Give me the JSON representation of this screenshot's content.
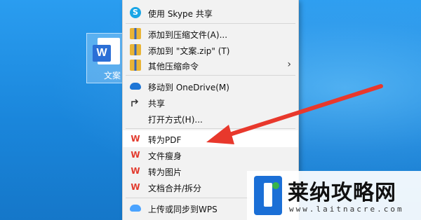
{
  "desktop": {
    "file_icon": {
      "name": "文案",
      "badge": "W"
    }
  },
  "context_menu": {
    "items": [
      {
        "label": "使用 Skype 共享",
        "icon": "skype-icon"
      },
      {
        "label": "添加到压缩文件(A)...",
        "icon": "archive-icon"
      },
      {
        "label": "添加到 \"文案.zip\" (T)",
        "icon": "archive-icon"
      },
      {
        "label": "其他压缩命令",
        "icon": "archive-icon",
        "submenu": true
      },
      {
        "label": "移动到 OneDrive(M)",
        "icon": "onedrive-icon"
      },
      {
        "label": "共享",
        "icon": "share-icon"
      },
      {
        "label": "打开方式(H)...",
        "icon": ""
      },
      {
        "label": "转为PDF",
        "icon": "wps-icon",
        "highlighted": true
      },
      {
        "label": "文件瘦身",
        "icon": "wps-icon"
      },
      {
        "label": "转为图片",
        "icon": "wps-icon"
      },
      {
        "label": "文档合并/拆分",
        "icon": "wps-icon"
      },
      {
        "label": "上传或同步到WPS",
        "icon": "cloud-icon"
      }
    ],
    "chevron": "›"
  },
  "overlay": {
    "brand": "莱纳攻略网",
    "domain": "www.laitnacre.com"
  },
  "colors": {
    "arrow": "#e8382c",
    "accent": "#1b6fd6"
  }
}
